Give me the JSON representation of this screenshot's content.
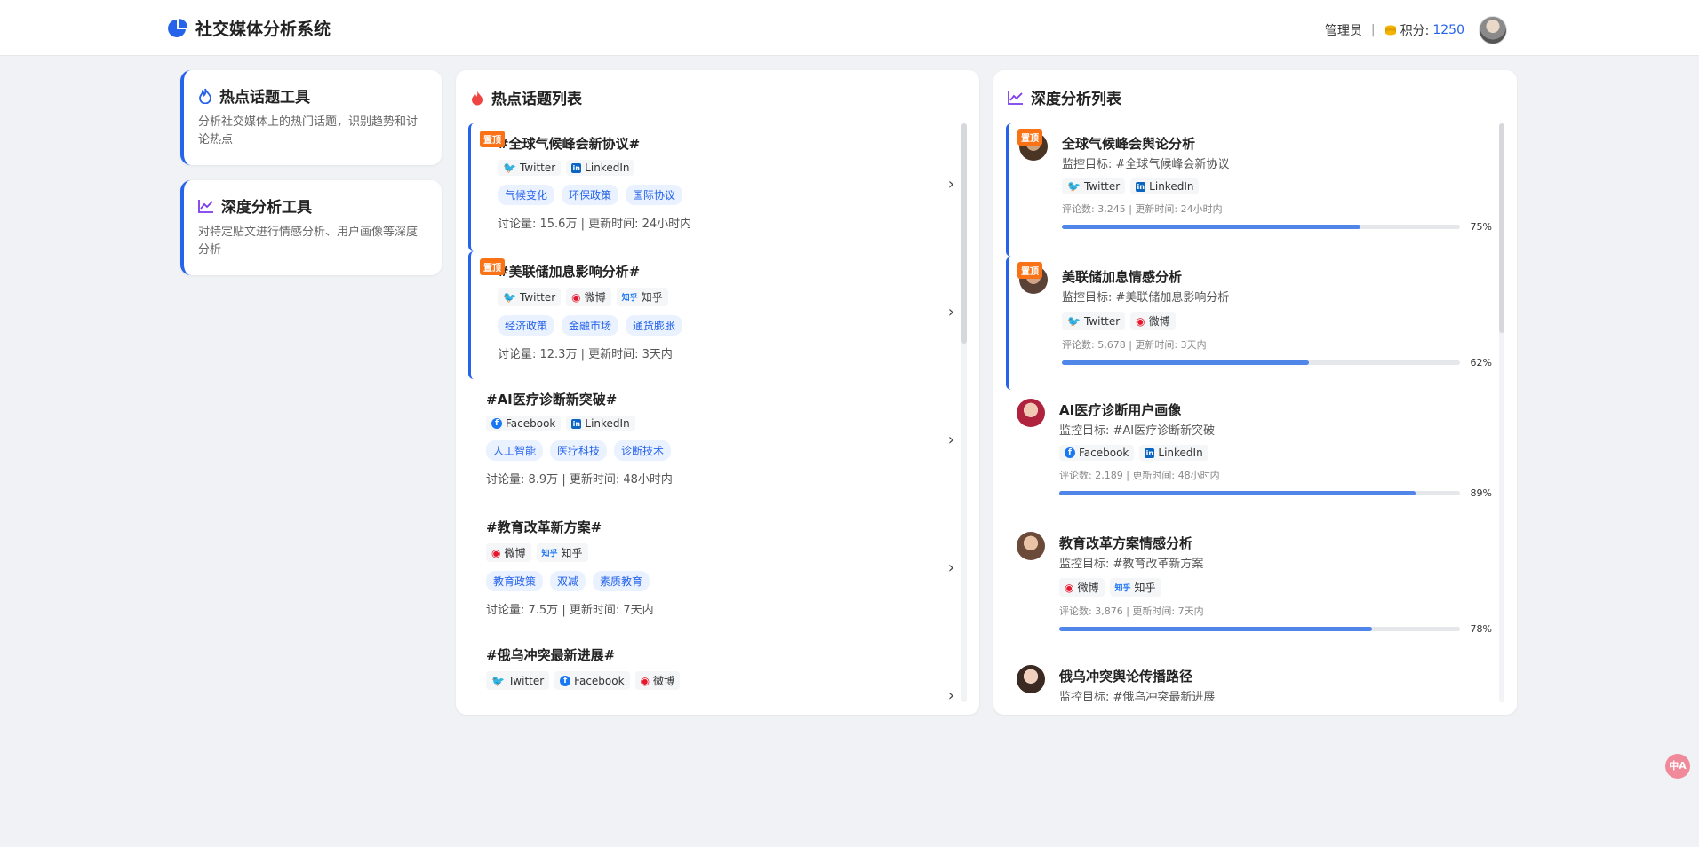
{
  "header": {
    "title": "社交媒体分析系统",
    "role": "管理员",
    "points_label": "积分:",
    "points_value": "1250"
  },
  "sidebar": {
    "tools": [
      {
        "title": "热点话题工具",
        "desc": "分析社交媒体上的热门话题，识别趋势和讨论热点"
      },
      {
        "title": "深度分析工具",
        "desc": "对特定贴文进行情感分析、用户画像等深度分析"
      }
    ]
  },
  "hot_topics": {
    "title": "热点话题列表",
    "pin_label": "置顶",
    "items": [
      {
        "title": "#全球气候峰会新协议#",
        "platforms": [
          "Twitter",
          "LinkedIn"
        ],
        "tags": [
          "气候变化",
          "环保政策",
          "国际协议"
        ],
        "meta": "讨论量: 15.6万 | 更新时间: 24小时内"
      },
      {
        "title": "#美联储加息影响分析#",
        "platforms": [
          "Twitter",
          "微博",
          "知乎"
        ],
        "tags": [
          "经济政策",
          "金融市场",
          "通货膨胀"
        ],
        "meta": "讨论量: 12.3万 | 更新时间: 3天内"
      },
      {
        "title": "#AI医疗诊断新突破#",
        "platforms": [
          "Facebook",
          "LinkedIn"
        ],
        "tags": [
          "人工智能",
          "医疗科技",
          "诊断技术"
        ],
        "meta": "讨论量: 8.9万 | 更新时间: 48小时内"
      },
      {
        "title": "#教育改革新方案#",
        "platforms": [
          "微博",
          "知乎"
        ],
        "tags": [
          "教育政策",
          "双减",
          "素质教育"
        ],
        "meta": "讨论量: 7.5万 | 更新时间: 7天内"
      },
      {
        "title": "#俄乌冲突最新进展#",
        "platforms": [
          "Twitter",
          "Facebook",
          "微博"
        ],
        "tags": [],
        "meta": ""
      }
    ]
  },
  "analysis": {
    "title": "深度分析列表",
    "pin_label": "置顶",
    "items": [
      {
        "title": "全球气候峰会舆论分析",
        "target": "监控目标: #全球气候峰会新协议",
        "platforms": [
          "Twitter",
          "LinkedIn"
        ],
        "meta": "评论数: 3,245 | 更新时间: 24小时内",
        "progress": 0.75,
        "progress_label": "75%"
      },
      {
        "title": "美联储加息情感分析",
        "target": "监控目标: #美联储加息影响分析",
        "platforms": [
          "Twitter",
          "微博"
        ],
        "meta": "评论数: 5,678 | 更新时间: 3天内",
        "progress": 0.62,
        "progress_label": "62%"
      },
      {
        "title": "AI医疗诊断用户画像",
        "target": "监控目标: #AI医疗诊断新突破",
        "platforms": [
          "Facebook",
          "LinkedIn"
        ],
        "meta": "评论数: 2,189 | 更新时间: 48小时内",
        "progress": 0.89,
        "progress_label": "89%"
      },
      {
        "title": "教育改革方案情感分析",
        "target": "监控目标: #教育改革新方案",
        "platforms": [
          "微博",
          "知乎"
        ],
        "meta": "评论数: 3,876 | 更新时间: 7天内",
        "progress": 0.78,
        "progress_label": "78%"
      },
      {
        "title": "俄乌冲突舆论传播路径",
        "target": "监控目标: #俄乌冲突最新进展",
        "platforms": [],
        "meta": "",
        "progress": null,
        "progress_label": ""
      }
    ]
  },
  "colors": {
    "accent": "#2563eb",
    "pin": "#f97316",
    "progress": "#4f86e8"
  },
  "translate_label": "中A"
}
